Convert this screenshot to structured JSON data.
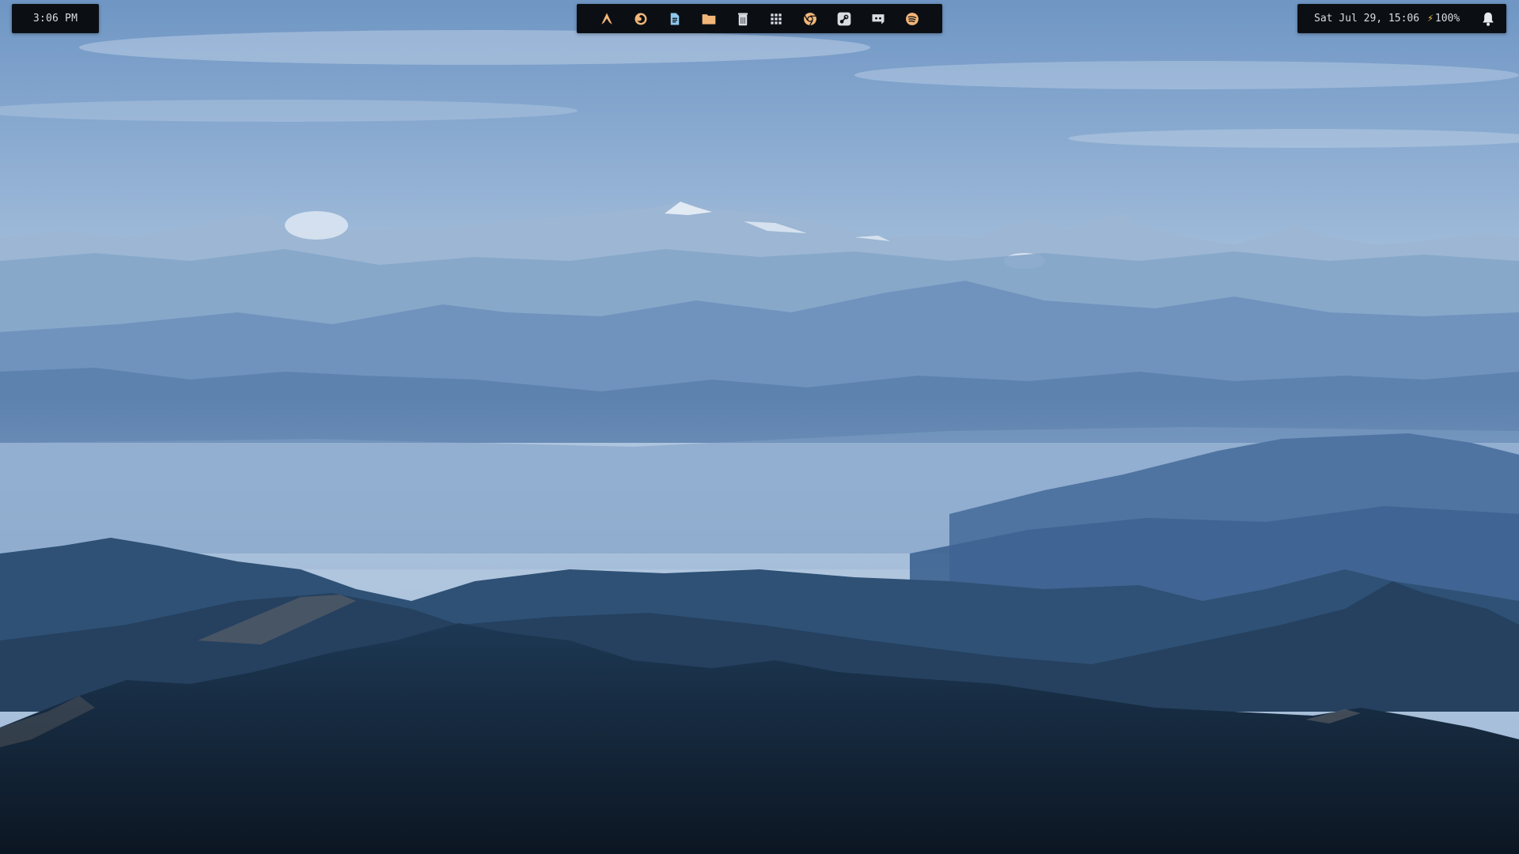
{
  "top_bar": {
    "left": {
      "time": "3:06 PM"
    },
    "dock": {
      "icon_color": "#f2b679",
      "items": [
        {
          "icon": "arch-linux-icon"
        },
        {
          "icon": "firefox-icon"
        },
        {
          "icon": "text-editor-icon"
        },
        {
          "icon": "folder-icon"
        },
        {
          "icon": "trash-icon"
        },
        {
          "icon": "app-grid-icon"
        },
        {
          "icon": "chrome-icon"
        },
        {
          "icon": "steam-icon"
        },
        {
          "icon": "discord-icon"
        },
        {
          "icon": "spotify-icon"
        }
      ]
    },
    "right": {
      "datetime": "Sat Jul 29, 15:06",
      "battery": "100%",
      "bolt_icon": "bolt-icon",
      "bell_icon": "bell-icon"
    }
  },
  "wallpaper": {
    "sky_top": "#7fa3cc",
    "sky_bottom": "#b7cbe2",
    "mountain_dark": "#0f1c2a"
  }
}
